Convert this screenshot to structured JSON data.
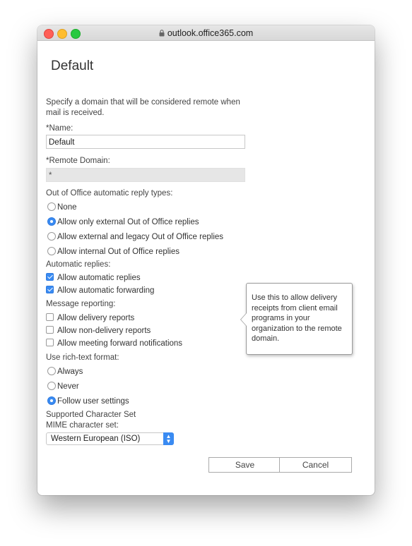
{
  "browser": {
    "url": "outlook.office365.com"
  },
  "page": {
    "heading": "Default",
    "description": "Specify a domain that will be considered remote when mail is received."
  },
  "name_field": {
    "label": "*Name:",
    "value": "Default"
  },
  "remote_domain_field": {
    "label": "*Remote Domain:",
    "value": "*"
  },
  "ooo_section": {
    "label": "Out of Office automatic reply types:",
    "options": [
      {
        "label": "None",
        "selected": false
      },
      {
        "label": "Allow only external Out of Office replies",
        "selected": true
      },
      {
        "label": "Allow external and legacy Out of Office replies",
        "selected": false
      },
      {
        "label": "Allow internal Out of Office replies",
        "selected": false
      }
    ]
  },
  "auto_replies_section": {
    "label": "Automatic replies:",
    "options": [
      {
        "label": "Allow automatic replies",
        "checked": true
      },
      {
        "label": "Allow automatic forwarding",
        "checked": true
      }
    ]
  },
  "message_reporting_section": {
    "label": "Message reporting:",
    "options": [
      {
        "label": "Allow delivery reports",
        "checked": false
      },
      {
        "label": "Allow non-delivery reports",
        "checked": false
      },
      {
        "label": "Allow meeting forward notifications",
        "checked": false
      }
    ]
  },
  "rich_text_section": {
    "label": "Use rich-text format:",
    "options": [
      {
        "label": "Always",
        "selected": false
      },
      {
        "label": "Never",
        "selected": false
      },
      {
        "label": "Follow user settings",
        "selected": true
      }
    ]
  },
  "charset_section": {
    "label": "Supported Character Set",
    "mime_label": "MIME character set:",
    "selected": "Western European (ISO)"
  },
  "tooltip": {
    "text": "Use this to allow delivery receipts from client email programs in your organization to the remote domain."
  },
  "buttons": {
    "save": "Save",
    "cancel": "Cancel"
  },
  "colors": {
    "accent": "#3a8bf2"
  }
}
